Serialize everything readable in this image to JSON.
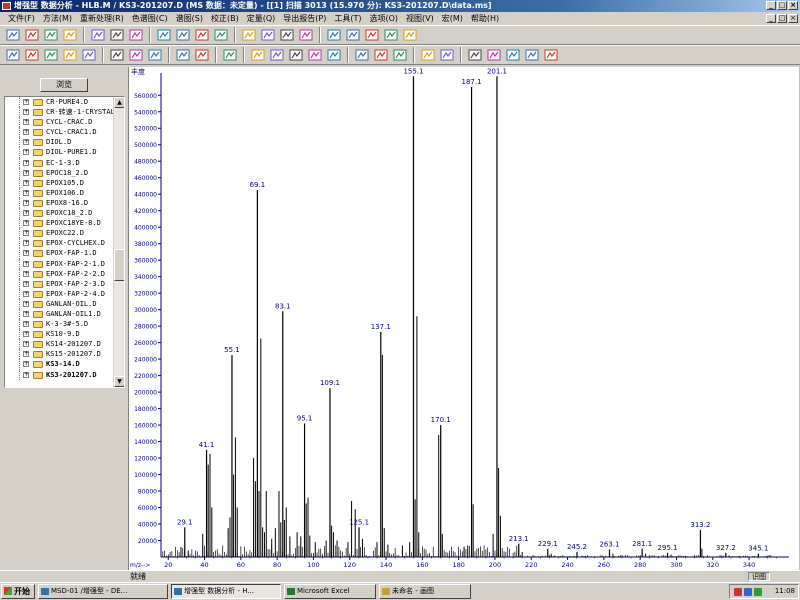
{
  "window": {
    "title": "增强型 数据分析 - HLB.M / KS3-201207.D    (MS 数据：未定量) - [[1] 扫描 3013 (15.970 分): KS3-201207.D\\data.ms]"
  },
  "menu": [
    "文件(F)",
    "方法(M)",
    "重新处理(R)",
    "色谱图(C)",
    "谱图(S)",
    "校正(B)",
    "定量(Q)",
    "导出报告(P)",
    "工具(T)",
    "选项(O)",
    "视图(V)",
    "宏(M)",
    "帮助(H)"
  ],
  "toolbar1": [
    "open-method-icon",
    "save-icon",
    "load-file-icon",
    "print-icon",
    "copy-icon",
    "paste-icon",
    "clipboard-icon",
    "copy-window-icon",
    "integrate-icon",
    "chrom-icon",
    "spectrum-icon",
    "fit-icon",
    "overlay-icon",
    "peak-icon",
    "library-icon",
    "tool-a-icon",
    "tool-b-icon",
    "tool-c-icon",
    "tool-d-icon",
    "tool-e-icon"
  ],
  "toolbar2": [
    "load-icon",
    "edit-icon",
    "settings-icon",
    "chart-icon",
    "labels-icon",
    "erase-icon",
    "color-icon",
    "baseline-icon",
    "help-icon",
    "stop-icon",
    "target-icon",
    "ion-a-icon",
    "ion-b-icon",
    "ion-c-icon",
    "ion-d-icon",
    "ion-e-icon",
    "peak-a-icon",
    "peak-b-icon",
    "peak-c-icon",
    "blank-icon",
    "check-icon",
    "report-a-icon",
    "report-b-icon",
    "report-c-icon",
    "report-d-icon",
    "report-e-icon"
  ],
  "left_panel": {
    "browse_label": "浏览",
    "files": [
      {
        "name": "CR-PURE4.D",
        "bold": false
      },
      {
        "name": "CR-转速-1-CRYSTAL",
        "bold": false
      },
      {
        "name": "CYCL-CRAC.D",
        "bold": false
      },
      {
        "name": "CYCL-CRAC1.D",
        "bold": false
      },
      {
        "name": "DIOL.D",
        "bold": false
      },
      {
        "name": "DIOL-PURE1.D",
        "bold": false
      },
      {
        "name": "EC-1-3.D",
        "bold": false
      },
      {
        "name": "EPOC18_2.D",
        "bold": false
      },
      {
        "name": "EPOX105.D",
        "bold": false
      },
      {
        "name": "EPOX106.D",
        "bold": false
      },
      {
        "name": "EPOX8-16.D",
        "bold": false
      },
      {
        "name": "EPOXC18_2.D",
        "bold": false
      },
      {
        "name": "EPOXC18YE-8.D",
        "bold": false
      },
      {
        "name": "EPOXC22.D",
        "bold": false
      },
      {
        "name": "EPOX-CYCLHEX.D",
        "bold": false
      },
      {
        "name": "EPOX-FAP-1.D",
        "bold": false
      },
      {
        "name": "EPOX-FAP-2-1.D",
        "bold": false
      },
      {
        "name": "EPOX-FAP-2-2.D",
        "bold": false
      },
      {
        "name": "EPOX-FAP-2-3.D",
        "bold": false
      },
      {
        "name": "EPOX-FAP-2-4.D",
        "bold": false
      },
      {
        "name": "GANLAN-OIL.D",
        "bold": false
      },
      {
        "name": "GANLAN-OIL1.D",
        "bold": false
      },
      {
        "name": "K-3-3#-5.D",
        "bold": false
      },
      {
        "name": "KS10-9.D",
        "bold": false
      },
      {
        "name": "KS14-201207.D",
        "bold": false
      },
      {
        "name": "KS15-201207.D",
        "bold": false
      },
      {
        "name": "KS3-14.D",
        "bold": true
      },
      {
        "name": "KS3-201207.D",
        "bold": true
      }
    ]
  },
  "chart_data": {
    "type": "bar",
    "ylabel": "丰度",
    "xlabel": "m/z-->",
    "xlim": [
      16,
      362
    ],
    "ylim": [
      0,
      587000
    ],
    "x_ticks": [
      20,
      40,
      60,
      80,
      100,
      120,
      140,
      160,
      180,
      200,
      220,
      240,
      260,
      280,
      300,
      320,
      340
    ],
    "y_ticks": [
      20000,
      40000,
      60000,
      80000,
      100000,
      120000,
      140000,
      160000,
      180000,
      200000,
      220000,
      240000,
      260000,
      280000,
      300000,
      320000,
      340000,
      360000,
      380000,
      400000,
      420000,
      440000,
      460000,
      480000,
      500000,
      520000,
      540000,
      560000
    ],
    "y_tick_labels": [
      "20000",
      "40000",
      "60000",
      "80000",
      "100000",
      "120000",
      "140000",
      "160000",
      "180000",
      "200000",
      "220000",
      "240000",
      "260000",
      "280000",
      "300000",
      "320000",
      "340000",
      "360000",
      "380000",
      "400000",
      "420000",
      "440000",
      "460000",
      "480000",
      "500000",
      "520000",
      "540000",
      "560000"
    ],
    "peaks": [
      {
        "mz": 29.1,
        "abundance": 36000,
        "label": "29.1"
      },
      {
        "mz": 41.1,
        "abundance": 130000,
        "label": "41.1"
      },
      {
        "mz": 55.1,
        "abundance": 245000,
        "label": "55.1"
      },
      {
        "mz": 69.1,
        "abundance": 445000,
        "label": "69.1"
      },
      {
        "mz": 83.1,
        "abundance": 298000,
        "label": "83.1"
      },
      {
        "mz": 95.1,
        "abundance": 162000,
        "label": "95.1"
      },
      {
        "mz": 109.1,
        "abundance": 205000,
        "label": "109.1"
      },
      {
        "mz": 125.1,
        "abundance": 36000,
        "label": "125.1"
      },
      {
        "mz": 137.1,
        "abundance": 273000,
        "label": "137.1"
      },
      {
        "mz": 155.1,
        "abundance": 583000,
        "label": "155.1"
      },
      {
        "mz": 170.1,
        "abundance": 160000,
        "label": "170.1"
      },
      {
        "mz": 187.1,
        "abundance": 570000,
        "label": "187.1"
      },
      {
        "mz": 201.1,
        "abundance": 583000,
        "label": "201.1"
      },
      {
        "mz": 213.1,
        "abundance": 16000,
        "label": "213.1"
      },
      {
        "mz": 229.1,
        "abundance": 10000,
        "label": "229.1"
      },
      {
        "mz": 245.2,
        "abundance": 6000,
        "label": "245.2"
      },
      {
        "mz": 263.1,
        "abundance": 9000,
        "label": "263.1"
      },
      {
        "mz": 281.1,
        "abundance": 10000,
        "label": "281.1"
      },
      {
        "mz": 295.1,
        "abundance": 5000,
        "label": "295.1"
      },
      {
        "mz": 313.2,
        "abundance": 33000,
        "label": "313.2"
      },
      {
        "mz": 327.2,
        "abundance": 5000,
        "label": "327.2"
      },
      {
        "mz": 345.1,
        "abundance": 4000,
        "label": "345.1"
      }
    ],
    "minor_peaks": [
      {
        "mz": 27,
        "abundance": 12000
      },
      {
        "mz": 31,
        "abundance": 8000
      },
      {
        "mz": 39,
        "abundance": 28000
      },
      {
        "mz": 42,
        "abundance": 112000
      },
      {
        "mz": 43,
        "abundance": 125000
      },
      {
        "mz": 44,
        "abundance": 60000
      },
      {
        "mz": 53,
        "abundance": 35000
      },
      {
        "mz": 54,
        "abundance": 48000
      },
      {
        "mz": 56,
        "abundance": 100000
      },
      {
        "mz": 57,
        "abundance": 145000
      },
      {
        "mz": 58,
        "abundance": 60000
      },
      {
        "mz": 67,
        "abundance": 120000
      },
      {
        "mz": 68,
        "abundance": 92000
      },
      {
        "mz": 70,
        "abundance": 80000
      },
      {
        "mz": 71,
        "abundance": 265000
      },
      {
        "mz": 72,
        "abundance": 36000
      },
      {
        "mz": 73,
        "abundance": 30000
      },
      {
        "mz": 74,
        "abundance": 80000
      },
      {
        "mz": 77,
        "abundance": 22000
      },
      {
        "mz": 79,
        "abundance": 35000
      },
      {
        "mz": 81,
        "abundance": 80000
      },
      {
        "mz": 82,
        "abundance": 42000
      },
      {
        "mz": 84,
        "abundance": 45000
      },
      {
        "mz": 85,
        "abundance": 60000
      },
      {
        "mz": 87,
        "abundance": 25000
      },
      {
        "mz": 91,
        "abundance": 30000
      },
      {
        "mz": 93,
        "abundance": 25000
      },
      {
        "mz": 96,
        "abundance": 65000
      },
      {
        "mz": 97,
        "abundance": 72000
      },
      {
        "mz": 98,
        "abundance": 26000
      },
      {
        "mz": 101,
        "abundance": 18000
      },
      {
        "mz": 107,
        "abundance": 20000
      },
      {
        "mz": 110,
        "abundance": 38000
      },
      {
        "mz": 111,
        "abundance": 30000
      },
      {
        "mz": 113,
        "abundance": 20000
      },
      {
        "mz": 119,
        "abundance": 18000
      },
      {
        "mz": 121,
        "abundance": 68000
      },
      {
        "mz": 123,
        "abundance": 58000
      },
      {
        "mz": 127,
        "abundance": 22000
      },
      {
        "mz": 135,
        "abundance": 18000
      },
      {
        "mz": 138,
        "abundance": 245000
      },
      {
        "mz": 139,
        "abundance": 35000
      },
      {
        "mz": 141,
        "abundance": 15000
      },
      {
        "mz": 149,
        "abundance": 14000
      },
      {
        "mz": 153,
        "abundance": 18000
      },
      {
        "mz": 156,
        "abundance": 70000
      },
      {
        "mz": 157,
        "abundance": 292000
      },
      {
        "mz": 158,
        "abundance": 30000
      },
      {
        "mz": 169,
        "abundance": 148000
      },
      {
        "mz": 171,
        "abundance": 28000
      },
      {
        "mz": 183,
        "abundance": 12000
      },
      {
        "mz": 185,
        "abundance": 14000
      },
      {
        "mz": 188,
        "abundance": 64000
      },
      {
        "mz": 199,
        "abundance": 28000
      },
      {
        "mz": 202,
        "abundance": 108000
      },
      {
        "mz": 203,
        "abundance": 50000
      },
      {
        "mz": 215,
        "abundance": 6000
      },
      {
        "mz": 231,
        "abundance": 4000
      },
      {
        "mz": 265,
        "abundance": 4000
      },
      {
        "mz": 283,
        "abundance": 4000
      },
      {
        "mz": 297,
        "abundance": 3000
      },
      {
        "mz": 314,
        "abundance": 10000
      },
      {
        "mz": 329,
        "abundance": 2000
      }
    ],
    "bar_color": "#000000",
    "label_color": "#00007f",
    "axis_color": "#00007f",
    "background": "#ffffff"
  },
  "status": {
    "left": "就绪",
    "right": "识图"
  },
  "taskbar": {
    "start": "开始",
    "tasks": [
      {
        "label": "MSD-01 /增强型 - DE...",
        "active": false
      },
      {
        "label": "增强型 数据分析 - H...",
        "active": true
      },
      {
        "label": "Microsoft Excel",
        "active": false
      },
      {
        "label": "未命名 - 画图",
        "active": false
      }
    ],
    "clock": "11:08"
  }
}
